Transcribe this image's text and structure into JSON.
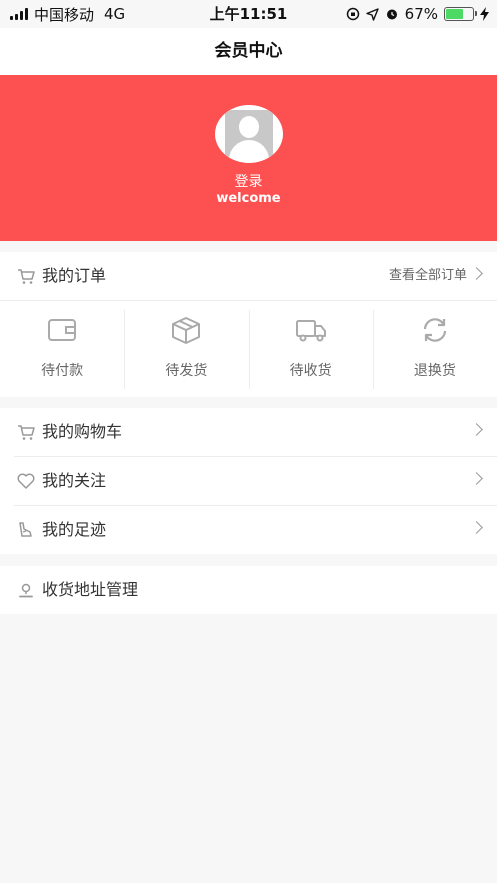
{
  "status_bar": {
    "carrier": "中国移动",
    "network": "4G",
    "time": "上午11:51",
    "battery_percent": "67%",
    "battery_level": 0.67
  },
  "nav": {
    "title": "会员中心"
  },
  "profile": {
    "login_label": "登录",
    "welcome_label": "welcome"
  },
  "orders": {
    "title": "我的订单",
    "view_all": "查看全部订单",
    "statuses": [
      {
        "label": "待付款",
        "icon": "wallet-icon"
      },
      {
        "label": "待发货",
        "icon": "package-icon"
      },
      {
        "label": "待收货",
        "icon": "truck-icon"
      },
      {
        "label": "退换货",
        "icon": "refresh-icon"
      }
    ]
  },
  "menu": {
    "items": [
      {
        "label": "我的购物车",
        "icon": "cart-icon"
      },
      {
        "label": "我的关注",
        "icon": "heart-icon"
      },
      {
        "label": "我的足迹",
        "icon": "footprint-icon"
      }
    ]
  },
  "address": {
    "label": "收货地址管理",
    "icon": "location-pin-icon"
  },
  "colors": {
    "brand_red": "#fd5151",
    "background": "#f7f7f7",
    "battery_green": "#4cd964"
  }
}
